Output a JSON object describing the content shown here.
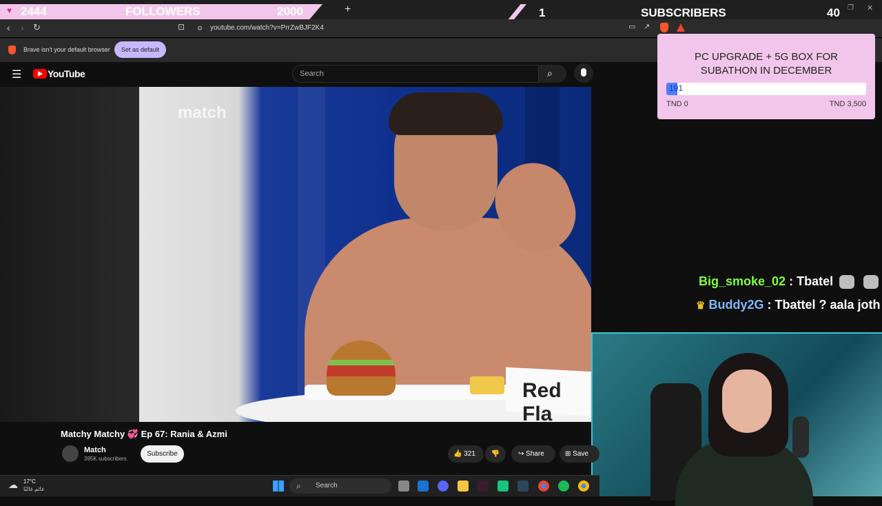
{
  "overlay": {
    "followers": {
      "count": "2444",
      "label": "FOLLOWERS",
      "goal": "2000"
    },
    "subscribers": {
      "count": "1",
      "label": "SUBSCRIBERS",
      "goal": "40"
    },
    "goal_card": {
      "title_line1": "PC UPGRADE + 5G BOX FOR",
      "title_line2": "SUBATHON IN DECEMBER",
      "current": "191",
      "progress": 0.055,
      "min_label": "TND 0",
      "max_label": "TND 3,500"
    },
    "chat": [
      {
        "user": "Big_smoke_02",
        "message": " : Tbatel",
        "user_color": "#7fff3f"
      },
      {
        "user": "Buddy2G",
        "message": " : Tbattel ? aala joth",
        "user_color": "#7fb7ff"
      }
    ]
  },
  "browser": {
    "url": "youtube.com/watch?v=PrrZwBJF2K4",
    "new_tab": "+",
    "infobar_msg": "Brave isn't your default browser",
    "infobar_btn": "Set as default"
  },
  "youtube": {
    "logo_text": "YouTube",
    "search_placeholder": "Search",
    "video_title": "Matchy Matchy 💞 Ep 67: Rania & Azmi",
    "channel_name": "Match",
    "channel_subs": "395K subscribers",
    "subscribe_label": "Subscribe",
    "likes": "321",
    "share_label": "Share",
    "save_label": "Save"
  },
  "video_content": {
    "watermark": "match",
    "sign_text": "Red Fla"
  },
  "taskbar": {
    "weather_temp": "17°C",
    "weather_text": "غائم غالبًا",
    "search_label": "Search"
  }
}
